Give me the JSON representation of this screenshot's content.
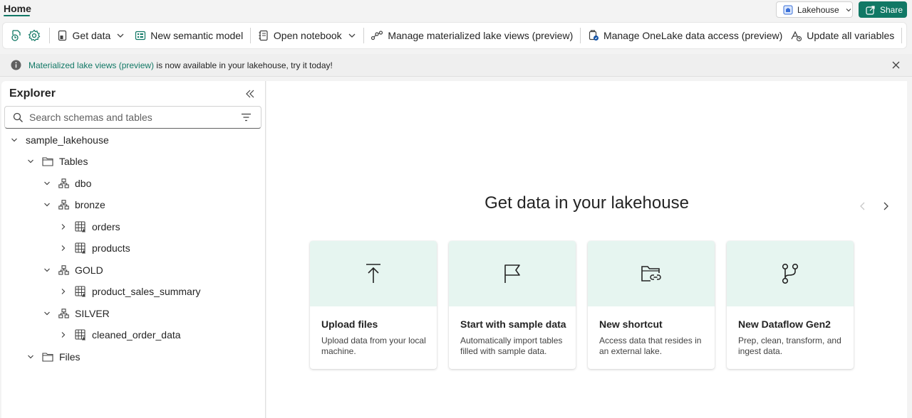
{
  "tabs": {
    "home": "Home"
  },
  "header": {
    "lakehouse_label": "Lakehouse",
    "share_label": "Share"
  },
  "ribbon": {
    "get_data": "Get data",
    "new_semantic_model": "New semantic model",
    "open_notebook": "Open notebook",
    "manage_mlv": "Manage materialized lake views (preview)",
    "manage_onelake": "Manage OneLake data access (preview)",
    "update_variables": "Update all variables"
  },
  "banner": {
    "link_text": "Materialized lake views (preview)",
    "text": " is now available in your lakehouse, try it today!"
  },
  "explorer": {
    "title": "Explorer",
    "search_placeholder": "Search schemas and tables",
    "tree": {
      "root": "sample_lakehouse",
      "tables": "Tables",
      "schemas": [
        {
          "name": "dbo",
          "tables": []
        },
        {
          "name": "bronze",
          "tables": [
            "orders",
            "products"
          ]
        },
        {
          "name": "GOLD",
          "tables": [
            "product_sales_summary"
          ]
        },
        {
          "name": "SILVER",
          "tables": [
            "cleaned_order_data"
          ]
        }
      ],
      "files": "Files"
    }
  },
  "main": {
    "title": "Get data in your lakehouse",
    "cards": [
      {
        "icon": "upload-icon",
        "title": "Upload files",
        "description": "Upload data from your local machine."
      },
      {
        "icon": "flag-icon",
        "title": "Start with sample data",
        "description": "Automatically import tables filled with sample data."
      },
      {
        "icon": "folder-link-icon",
        "title": "New shortcut",
        "description": "Access data that resides in an external lake."
      },
      {
        "icon": "branch-icon",
        "title": "New Dataflow Gen2",
        "description": "Prep, clean, transform, and ingest data."
      }
    ]
  },
  "colors": {
    "accent": "#117865",
    "card_top": "#e6f5f0"
  }
}
